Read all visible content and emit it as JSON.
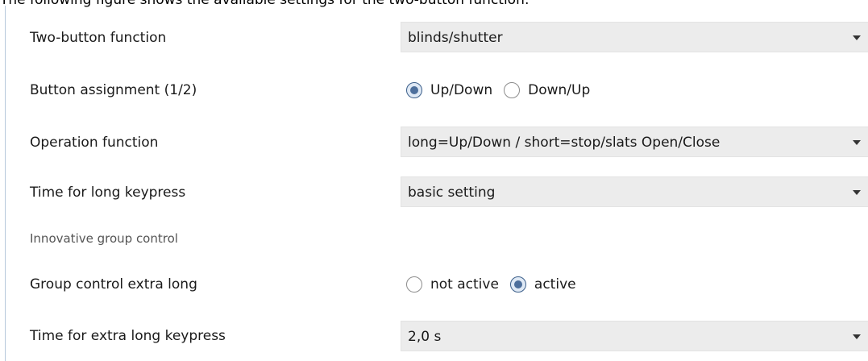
{
  "caption": "The following figure shows the available settings for the two-button function:",
  "rows": {
    "two_button": {
      "label": "Two-button function",
      "value": "blinds/shutter"
    },
    "assignment": {
      "label": "Button assignment (1/2)",
      "options": [
        "Up/Down",
        "Down/Up"
      ],
      "selected": "Up/Down"
    },
    "operation": {
      "label": "Operation function",
      "value": "long=Up/Down / short=stop/slats Open/Close"
    },
    "long_keypress": {
      "label": "Time for long keypress",
      "value": "basic setting"
    },
    "section_title": "Innovative group control",
    "group_control": {
      "label": "Group control extra long",
      "options": [
        "not active",
        "active"
      ],
      "selected": "active"
    },
    "extra_long_keypress": {
      "label": "Time for extra long keypress",
      "value": "2,0 s"
    }
  },
  "icons": {
    "dropdown_arrow": "chevron-down-icon",
    "radio": "radio-button-icon"
  },
  "colors": {
    "dropdown_bg": "#ececec",
    "radio_checked": "#4d6f9c",
    "panel_border": "#b7c9dc"
  }
}
